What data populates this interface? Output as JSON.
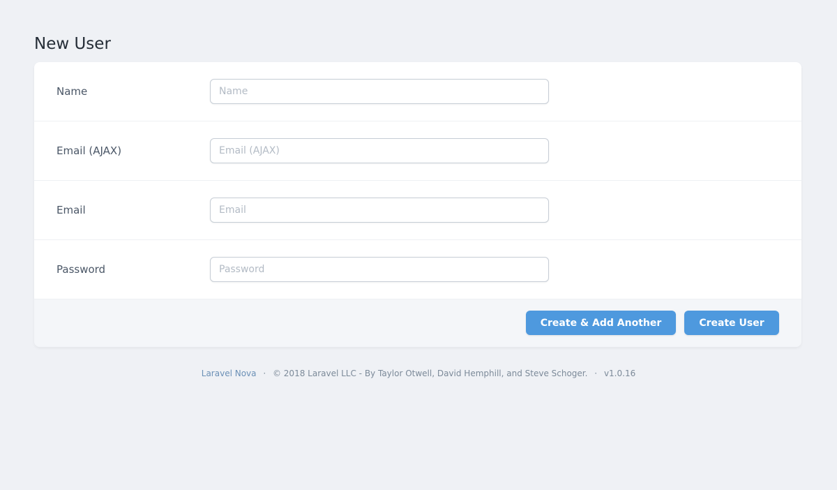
{
  "page": {
    "title": "New User"
  },
  "form": {
    "fields": [
      {
        "label": "Name",
        "placeholder": "Name",
        "value": ""
      },
      {
        "label": "Email (AJAX)",
        "placeholder": "Email (AJAX)",
        "value": ""
      },
      {
        "label": "Email",
        "placeholder": "Email",
        "value": ""
      },
      {
        "label": "Password",
        "placeholder": "Password",
        "value": ""
      }
    ],
    "buttons": {
      "create_another": "Create & Add Another",
      "create": "Create User"
    }
  },
  "footer": {
    "link": "Laravel Nova",
    "separator": "·",
    "copyright": "© 2018 Laravel LLC - By Taylor Otwell, David Hemphill, and Steve Schoger.",
    "version": "v1.0.16"
  },
  "colors": {
    "accent": "#4e99de",
    "background": "#eff1f5"
  }
}
